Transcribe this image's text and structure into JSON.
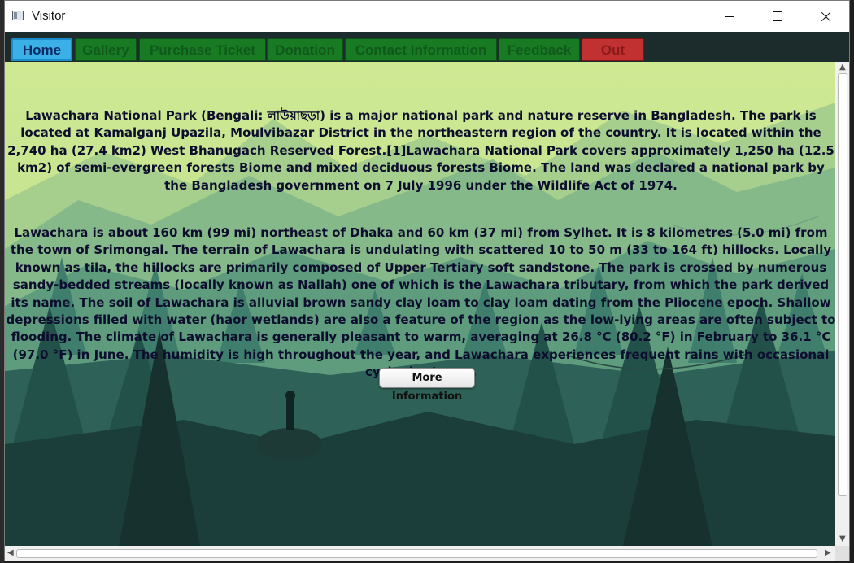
{
  "window": {
    "title": "Visitor"
  },
  "tabs": [
    {
      "label": "Home",
      "state": "active"
    },
    {
      "label": "Gallery",
      "state": "normal"
    },
    {
      "label": "Purchase Ticket",
      "state": "normal"
    },
    {
      "label": "Donation",
      "state": "normal"
    },
    {
      "label": "Contact Information",
      "state": "normal"
    },
    {
      "label": "Feedback",
      "state": "normal"
    },
    {
      "label": "Out",
      "state": "danger"
    }
  ],
  "content": {
    "paragraph1": "Lawachara National Park (Bengali: লাউয়াছড়া) is a major national park and nature reserve in Bangladesh. The park is located at Kamalganj Upazila, Moulvibazar District in the northeastern region of the country. It is located within the 2,740 ha (27.4 km2) West Bhanugach Reserved Forest.[1]Lawachara National Park covers approximately 1,250 ha (12.5 km2) of semi-evergreen forests Biome and mixed deciduous forests Biome. The land was declared a national park by the Bangladesh government on 7 July 1996 under the Wildlife Act of 1974.",
    "paragraph2": "Lawachara is about 160 km (99 mi) northeast of Dhaka and 60 km (37 mi) from Sylhet. It is 8 kilometres (5.0 mi) from the town of Srimongal. The terrain of Lawachara is undulating with scattered 10 to 50 m (33 to 164 ft) hillocks. Locally known as tila, the hillocks are primarily composed of Upper Tertiary soft sandstone. The park is crossed by numerous sandy-bedded streams (locally known as Nallah) one of which is the Lawachara tributary, from which the park derived its name. The soil of Lawachara is alluvial brown sandy clay loam to clay loam dating from the Pliocene epoch. Shallow depressions filled with water (haor wetlands) are also a feature of the region as the low-lying areas are often subject to flooding. The climate of Lawachara is generally pleasant to warm, averaging at 26.8 °C (80.2 °F) in February to 36.1 °C (97.0 °F) in June. The humidity is high throughout the year, and Lawachara experiences frequent rains with occasional cyclonic storms.",
    "more_button": "More Information"
  },
  "colors": {
    "sky": "#c9e690",
    "tab_normal": "#197a24",
    "tab_active": "#3ab0e6",
    "tab_danger": "#c23131",
    "text": "#0d0d2e"
  },
  "icons": {
    "app": "window-icon",
    "minimize": "minimize-icon",
    "maximize": "maximize-icon",
    "close": "close-icon"
  }
}
